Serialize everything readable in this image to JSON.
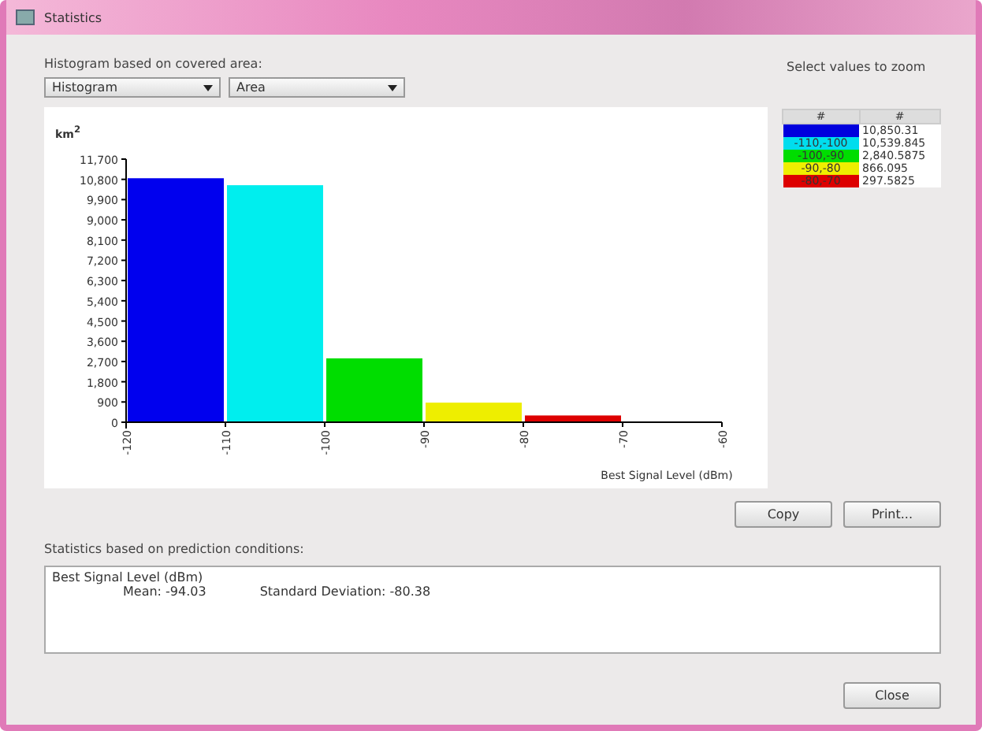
{
  "window": {
    "title": "Statistics"
  },
  "histogram": {
    "heading": "Histogram based on covered area:",
    "dropdowns": [
      {
        "value": "Histogram"
      },
      {
        "value": "Area"
      }
    ],
    "chart_data": {
      "type": "bar",
      "xlabel": "Best Signal Level (dBm)",
      "ylabel": "km$^{2}$",
      "x": [
        -115,
        -105,
        -95,
        -85,
        -75
      ],
      "series": [
        {
          "color": "#0000ee",
          "values": [
            10850,
            null,
            null,
            null,
            null
          ]
        },
        {
          "color": "#00eeee",
          "values": [
            null,
            10540,
            null,
            null,
            null
          ]
        },
        {
          "color": "#00dd00",
          "values": [
            null,
            null,
            2840,
            null,
            null
          ]
        },
        {
          "color": "#eeee00",
          "values": [
            null,
            null,
            null,
            870,
            null
          ]
        },
        {
          "color": "#dd0000",
          "values": [
            null,
            null,
            null,
            null,
            300
          ]
        }
      ],
      "xlim": [
        -120,
        -60
      ],
      "xticks": [
        -120,
        -110,
        -100,
        -90,
        -80,
        -70,
        -60
      ],
      "ylim": [
        0,
        11700
      ],
      "yticks": [
        {
          "value": 0,
          "label": "0"
        },
        {
          "value": 900,
          "label": "900"
        },
        {
          "value": 1800,
          "label": "1,800"
        },
        {
          "value": 2700,
          "label": "2,700"
        },
        {
          "value": 3600,
          "label": "3,600"
        },
        {
          "value": 4500,
          "label": "4,500"
        },
        {
          "value": 5400,
          "label": "5,400"
        },
        {
          "value": 6300,
          "label": "6,300"
        },
        {
          "value": 7200,
          "label": "7,200"
        },
        {
          "value": 8100,
          "label": "8,100"
        },
        {
          "value": 9000,
          "label": "9,000"
        },
        {
          "value": 9900,
          "label": "9,900"
        },
        {
          "value": 10800,
          "label": "10,800"
        },
        {
          "value": 11700,
          "label": "11,700"
        }
      ]
    }
  },
  "zoom_table": {
    "heading": "Select values to zoom",
    "columns": [
      "#",
      "#"
    ],
    "rows": [
      {
        "range": "",
        "value": "10,850.31",
        "color": "#0000dd"
      },
      {
        "range": "-110,-100",
        "value": "10,539.845",
        "color": "#00ddee"
      },
      {
        "range": "-100,-90",
        "value": "2,840.5875",
        "color": "#00dd00"
      },
      {
        "range": "-90,-80",
        "value": "866.095",
        "color": "#eeee00"
      },
      {
        "range": "-80,-70",
        "value": "297.5825",
        "color": "#dd0000"
      }
    ]
  },
  "chart_buttons": [
    "Copy",
    "Print..."
  ],
  "statistics": {
    "heading": "Statistics based on prediction conditions:",
    "title": "Best Signal Level (dBm)",
    "mean": "Mean: -94.03",
    "deviation": "Standard Deviation: -80.38"
  },
  "buttons": [
    "Close"
  ]
}
